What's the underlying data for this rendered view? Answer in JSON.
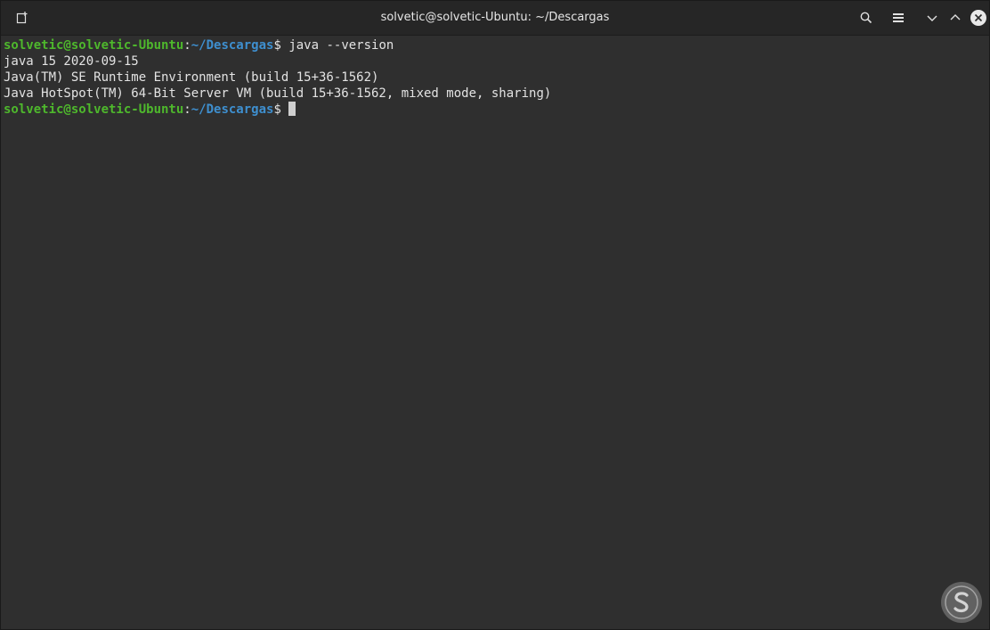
{
  "window": {
    "title": "solvetic@solvetic-Ubuntu: ~/Descargas"
  },
  "titlebar": {
    "icons": [
      "new-tab-icon",
      "search-icon",
      "hamburger-menu-icon",
      "chevron-down-icon",
      "chevron-up-icon",
      "close-icon"
    ]
  },
  "terminal": {
    "prompt": {
      "user_host": "solvetic@solvetic-Ubuntu",
      "colon": ":",
      "path": "~/Descargas",
      "symbol": "$"
    },
    "command": " java --version",
    "output": [
      "java 15 2020-09-15",
      "Java(TM) SE Runtime Environment (build 15+36-1562)",
      "Java HotSpot(TM) 64-Bit Server VM (build 15+36-1562, mixed mode, sharing)"
    ]
  },
  "colors": {
    "background": "#2f2f2f",
    "prompt_user": "#4eb82c",
    "prompt_path": "#3e8fcf",
    "text": "#e3e3e3"
  }
}
